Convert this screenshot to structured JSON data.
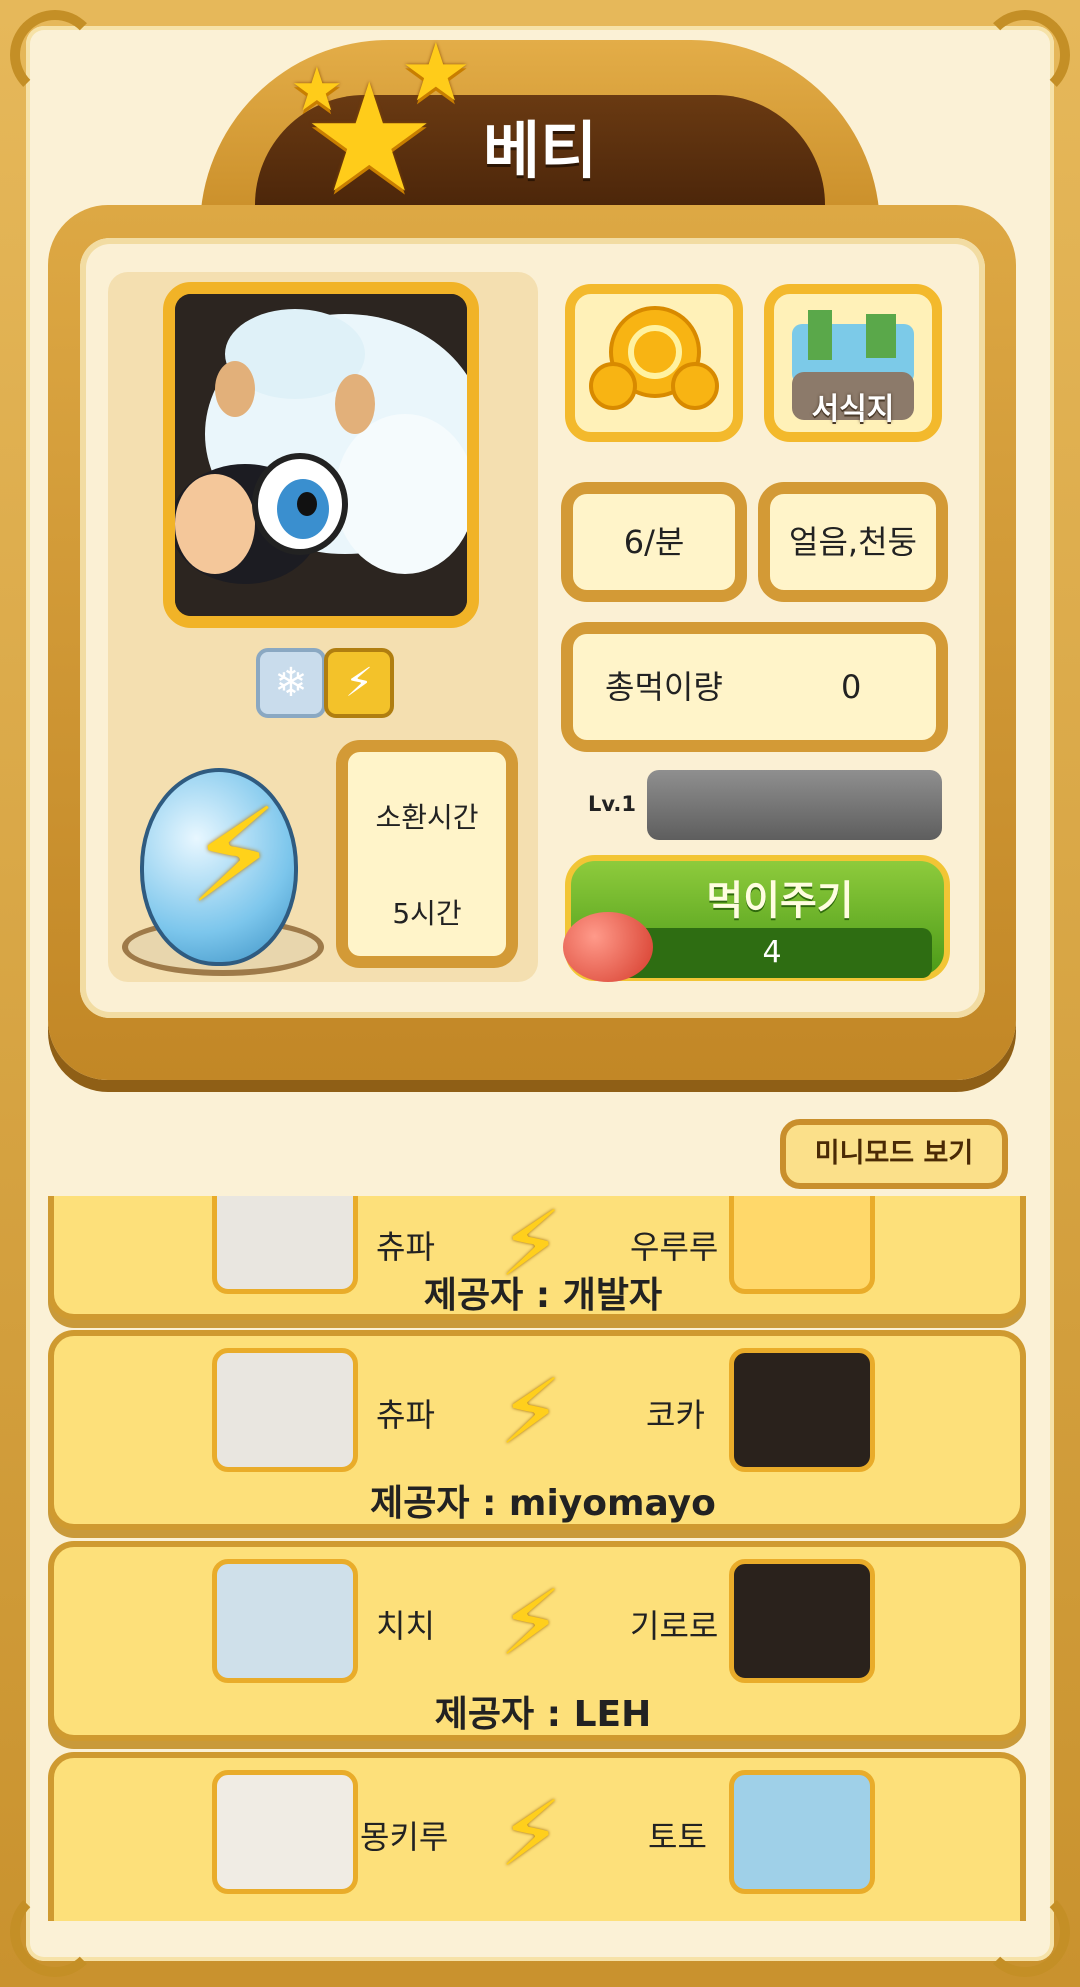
{
  "pet": {
    "name": "베티",
    "rate": "6/분",
    "elements": "얼음,천둥",
    "total_food_label": "총먹이량",
    "total_food_value": "0",
    "level": "Lv.1",
    "level_progress": 0,
    "summon_label": "소환시간",
    "summon_value": "5시간",
    "habitat_label": "서식지"
  },
  "feed": {
    "label": "먹이주기",
    "count": "4"
  },
  "minimode_label": "미니모드 보기",
  "combos": [
    {
      "left": "츄파",
      "right": "우루루",
      "provider": "제공자 : 개발자"
    },
    {
      "left": "츄파",
      "right": "코카",
      "provider": "제공자 : miyomayo"
    },
    {
      "left": "치치",
      "right": "기로로",
      "provider": "제공자 : LEH"
    },
    {
      "left": "몽키루",
      "right": "토토",
      "provider": ""
    }
  ],
  "colors": {
    "accent": "#f1b327",
    "card": "#fde07a",
    "feed": "#4b9a18"
  }
}
